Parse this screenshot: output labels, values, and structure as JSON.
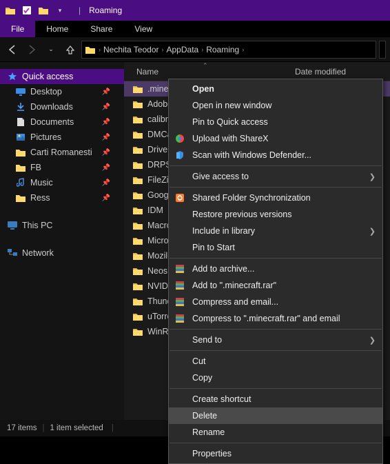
{
  "window": {
    "title": "Roaming"
  },
  "tabs": {
    "file": "File",
    "home": "Home",
    "share": "Share",
    "view": "View"
  },
  "breadcrumbs": [
    "Nechita Teodor",
    "AppData",
    "Roaming"
  ],
  "columns": {
    "name": "Name",
    "date": "Date modified"
  },
  "nav": {
    "quick_access": "Quick access",
    "items": [
      {
        "label": "Desktop",
        "icon": "desktop",
        "pin": true
      },
      {
        "label": "Downloads",
        "icon": "downloads",
        "pin": true
      },
      {
        "label": "Documents",
        "icon": "documents",
        "pin": true
      },
      {
        "label": "Pictures",
        "icon": "pictures",
        "pin": true
      },
      {
        "label": "Carti Romanesti",
        "icon": "folder",
        "pin": true
      },
      {
        "label": "FB",
        "icon": "folder",
        "pin": true
      },
      {
        "label": "Music",
        "icon": "music",
        "pin": true
      },
      {
        "label": "Ress",
        "icon": "folder",
        "pin": true
      }
    ],
    "this_pc": "This PC",
    "network": "Network"
  },
  "files": [
    {
      "name": ".minecr",
      "selected": true
    },
    {
      "name": "Adobe"
    },
    {
      "name": "calibre"
    },
    {
      "name": "DMCac"
    },
    {
      "name": "DriverP"
    },
    {
      "name": "DRPSu"
    },
    {
      "name": "FileZilla"
    },
    {
      "name": "Google"
    },
    {
      "name": "IDM"
    },
    {
      "name": "Macron"
    },
    {
      "name": "Microsc"
    },
    {
      "name": "Mozilla"
    },
    {
      "name": "Neos Eu"
    },
    {
      "name": "NVIDIA"
    },
    {
      "name": "Thunde"
    },
    {
      "name": "uTorren"
    },
    {
      "name": "WinRAR"
    }
  ],
  "status": {
    "count": "17 items",
    "selected": "1 item selected"
  },
  "context_menu": [
    {
      "label": "Open",
      "bold": true
    },
    {
      "label": "Open in new window"
    },
    {
      "label": "Pin to Quick access"
    },
    {
      "label": "Upload with ShareX",
      "icon": "sharex"
    },
    {
      "label": "Scan with Windows Defender...",
      "icon": "defender"
    },
    {
      "label": "Give access to",
      "arrow": true,
      "sep_before": true
    },
    {
      "label": "Shared Folder Synchronization",
      "icon": "sync",
      "sep_before": true
    },
    {
      "label": "Restore previous versions"
    },
    {
      "label": "Include in library",
      "arrow": true
    },
    {
      "label": "Pin to Start"
    },
    {
      "label": "Add to archive...",
      "icon": "winrar",
      "sep_before": true
    },
    {
      "label": "Add to \".minecraft.rar\"",
      "icon": "winrar"
    },
    {
      "label": "Compress and email...",
      "icon": "winrar"
    },
    {
      "label": "Compress to \".minecraft.rar\" and email",
      "icon": "winrar"
    },
    {
      "label": "Send to",
      "arrow": true,
      "sep_before": true
    },
    {
      "label": "Cut",
      "sep_before": true
    },
    {
      "label": "Copy"
    },
    {
      "label": "Create shortcut",
      "sep_before": true
    },
    {
      "label": "Delete",
      "highlight": true
    },
    {
      "label": "Rename"
    },
    {
      "label": "Properties",
      "sep_before": true
    }
  ]
}
